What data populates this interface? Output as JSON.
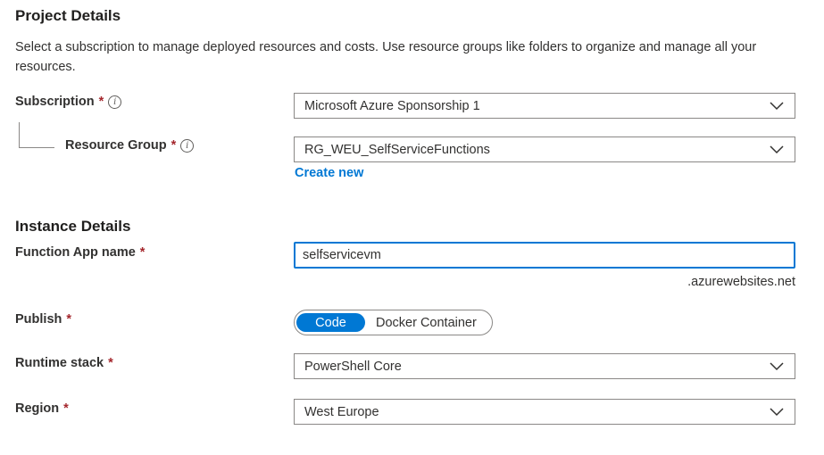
{
  "project": {
    "title": "Project Details",
    "description": "Select a subscription to manage deployed resources and costs. Use resource groups like folders to organize and manage all your resources."
  },
  "subscription": {
    "label": "Subscription",
    "required": "*",
    "info": "i",
    "value": "Microsoft Azure Sponsorship 1"
  },
  "resource_group": {
    "label": "Resource Group",
    "required": "*",
    "info": "i",
    "value": "RG_WEU_SelfServiceFunctions",
    "create_new": "Create new"
  },
  "instance": {
    "title": "Instance Details"
  },
  "function_app": {
    "label": "Function App name",
    "required": "*",
    "value": "selfservicevm",
    "suffix": ".azurewebsites.net"
  },
  "publish": {
    "label": "Publish",
    "required": "*",
    "options": [
      "Code",
      "Docker Container"
    ],
    "selected": "Code"
  },
  "runtime": {
    "label": "Runtime stack",
    "required": "*",
    "value": "PowerShell Core"
  },
  "region": {
    "label": "Region",
    "required": "*",
    "value": "West Europe"
  },
  "colors": {
    "accent": "#0078d4",
    "required": "#a4262c",
    "border": "#8a8886"
  },
  "icons": {
    "info": "info-icon",
    "dropdown": "chevron-down-icon"
  }
}
